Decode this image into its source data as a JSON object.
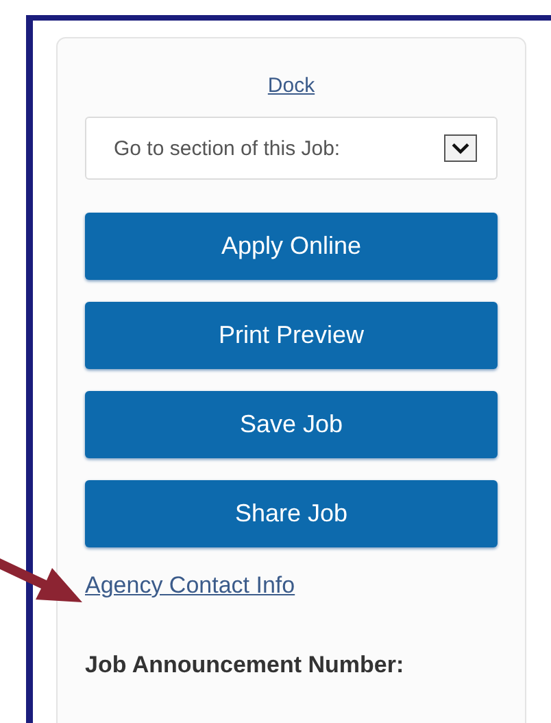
{
  "dock_link": "Dock",
  "section_select": {
    "value": "Go to section of this Job:"
  },
  "buttons": [
    "Apply Online",
    "Print Preview",
    "Save Job",
    "Share Job"
  ],
  "contact_link": "Agency Contact Info",
  "heading": "Job Announcement Number:"
}
